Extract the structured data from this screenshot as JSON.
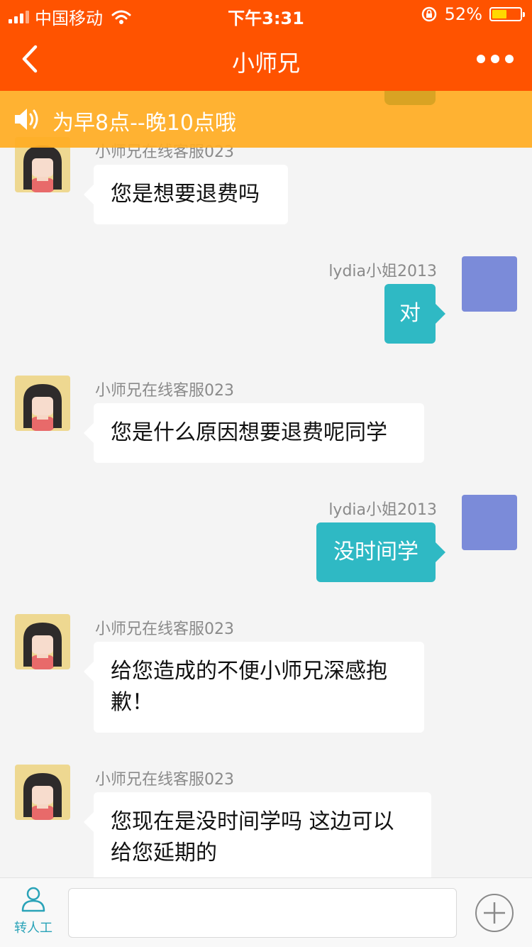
{
  "status_bar": {
    "carrier": "中国移动",
    "time": "下午3:31",
    "battery": "52%"
  },
  "nav": {
    "title": "小师兄"
  },
  "notice": {
    "text": "为早8点--晚10点哦"
  },
  "messages": [
    {
      "side": "in",
      "sender": "小师兄在线客服023",
      "text": "您是想要退费吗"
    },
    {
      "side": "out",
      "sender": "lydia小姐2013",
      "text": "对"
    },
    {
      "side": "in",
      "sender": "小师兄在线客服023",
      "text": "您是什么原因想要退费呢同学"
    },
    {
      "side": "out",
      "sender": "lydia小姐2013",
      "text": "没时间学"
    },
    {
      "side": "in",
      "sender": "小师兄在线客服023",
      "text": "给您造成的不便小师兄深感抱歉！"
    },
    {
      "side": "in",
      "sender": "小师兄在线客服023",
      "text": "您现在是没时间学吗 这边可以给您延期的"
    }
  ],
  "input_bar": {
    "human_label": "转人工",
    "placeholder": ""
  },
  "icons": {
    "back": "chevron-left-icon",
    "more": "more-dots-icon",
    "speaker": "speaker-icon",
    "human": "person-icon",
    "plus": "plus-circle-icon"
  },
  "colors": {
    "brand": "#ff5300",
    "notice": "#ffac22",
    "outgoing_bubble": "#2fb9c4",
    "user_avatar": "#7b8bd9"
  }
}
